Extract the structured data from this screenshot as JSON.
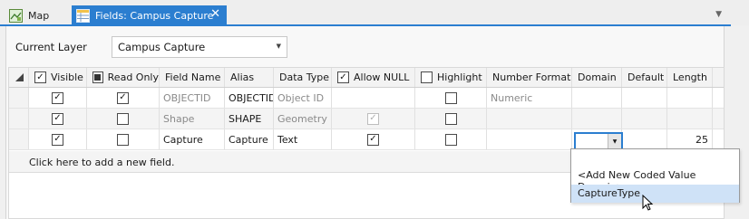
{
  "tabs": {
    "map_label": "Map",
    "fields_label": "Fields:  Campus Capture",
    "close_glyph": "✕"
  },
  "layer": {
    "label": "Current Layer",
    "value": "Campus Capture"
  },
  "columns": [
    "Visible",
    "Read Only",
    "Field Name",
    "Alias",
    "Data Type",
    "Allow NULL",
    "Highlight",
    "Number Format",
    "Domain",
    "Default",
    "Length"
  ],
  "rows": [
    {
      "visible": true,
      "read_only": true,
      "field_name": "OBJECTID",
      "alias": "OBJECTID",
      "data_type": "Object ID",
      "allow_null": false,
      "highlight": false,
      "number_format": "Numeric",
      "domain": "",
      "default": "",
      "length": ""
    },
    {
      "visible": true,
      "read_only": false,
      "field_name": "Shape",
      "alias": "SHAPE",
      "data_type": "Geometry",
      "allow_null": true,
      "highlight": false,
      "number_format": "",
      "domain": "",
      "default": "",
      "length": ""
    },
    {
      "visible": true,
      "read_only": false,
      "field_name": "Capture",
      "alias": "Capture",
      "data_type": "Text",
      "allow_null": true,
      "highlight": false,
      "number_format": "",
      "domain": "",
      "default": "",
      "length": "25"
    }
  ],
  "add_field_text": "Click here to add a new field.",
  "domain_dropdown": {
    "options": [
      "<Add New Coded Value Domain>",
      "CaptureType"
    ],
    "highlighted": "CaptureType"
  },
  "colors": {
    "accent": "#2b7ed0",
    "dropdown_highlight": "#cfe2f7"
  }
}
